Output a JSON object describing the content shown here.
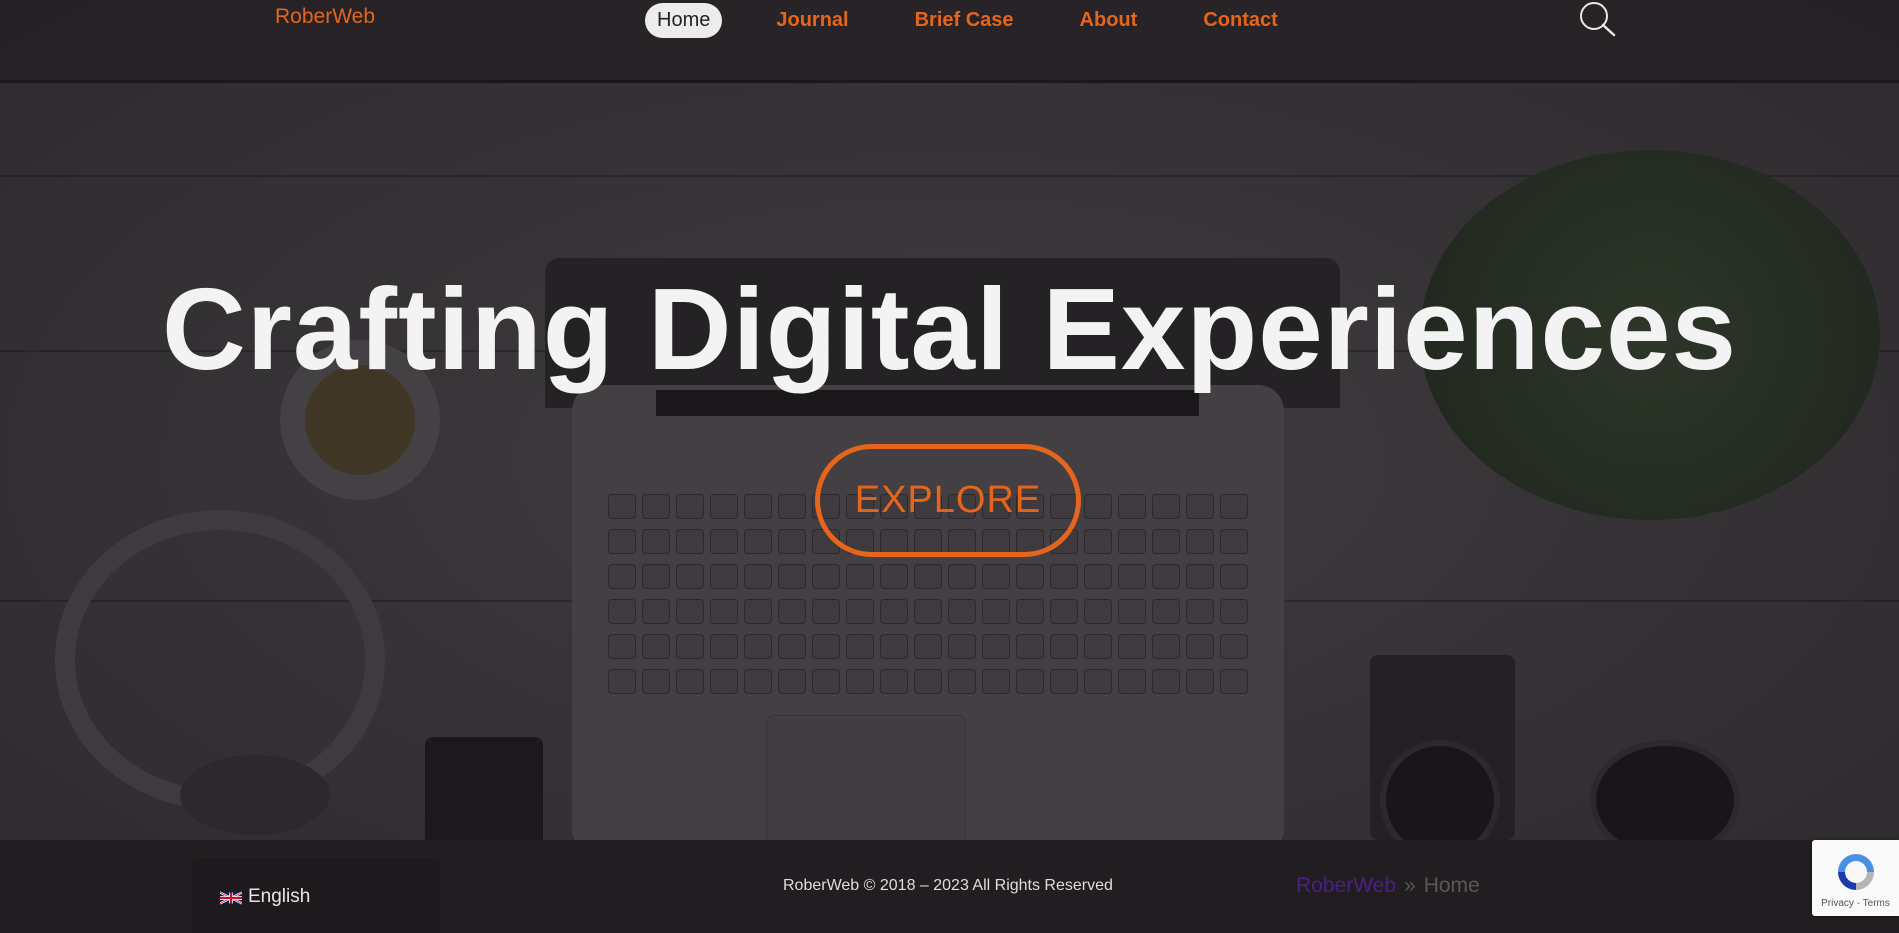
{
  "header": {
    "brand": "RoberWeb",
    "nav": [
      "Home",
      "Journal",
      "Brief Case",
      "About",
      "Contact"
    ],
    "active_nav": "Home"
  },
  "hero": {
    "title": "Crafting Digital Experiences",
    "cta_label": "EXPLORE"
  },
  "footer": {
    "language": "English",
    "copyright": "RoberWeb © 2018 – 2023 All Rights Reserved",
    "breadcrumb": {
      "home_link": "RoberWeb",
      "separator": "»",
      "current": "Home"
    }
  },
  "recaptcha": {
    "text": "Privacy - Terms"
  },
  "colors": {
    "accent": "#e5651c",
    "breadcrumb_link": "#4a1f86",
    "header_bg": "#221f22",
    "footer_bg": "#221d20"
  }
}
